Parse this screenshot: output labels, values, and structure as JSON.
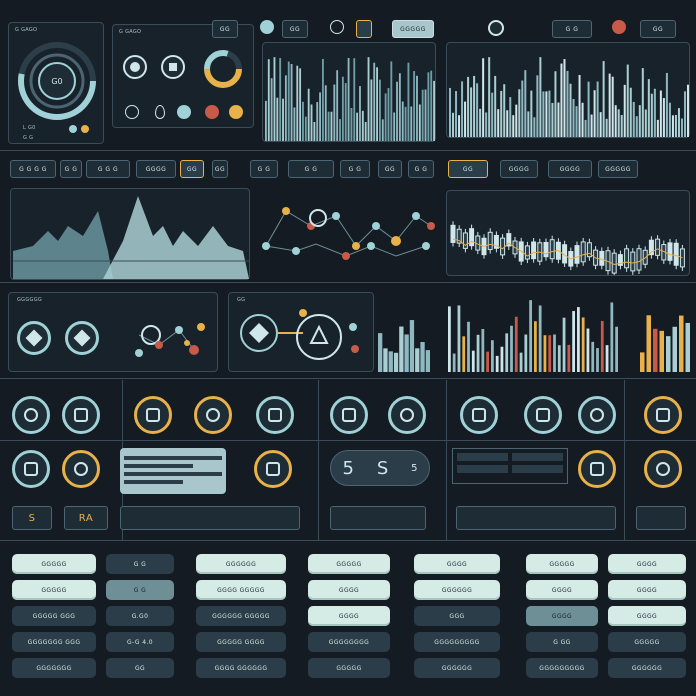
{
  "top": {
    "panel1_label": "G  GAGO",
    "panel2_label": "G  GAGO",
    "panel2_tag": "GG",
    "gauge_text": "G0",
    "mini_code": "L G0",
    "mini_code2": "G  G",
    "topbar_buttons": [
      "GG",
      "GG",
      "G  G",
      "GG"
    ],
    "topbar_right_label": "GGGGG",
    "topbar_pill2": "G  G"
  },
  "row2": {
    "buttons": [
      "G  G  G  G",
      "G G",
      "G  G  G",
      "GGGG",
      "GG",
      "GG",
      "G G",
      "G  G",
      "G  G",
      "GG",
      "G  G",
      "GG",
      "GGGG",
      "GGGG",
      "GGGGG"
    ]
  },
  "row3": {
    "section_label": "GGGGGG",
    "buttons": [
      "G",
      "G"
    ]
  },
  "row4": {
    "icon_names": [
      "hash-icon",
      "diamond-icon",
      "cat-icon",
      "monitor-icon",
      "laptop-icon",
      "target-icon",
      "dollar-icon",
      "puzzle-icon",
      "dollar-pin-icon",
      "frame-pin-icon",
      "infinity-icon"
    ],
    "s_label": "S",
    "s_tag": "5",
    "counter_text": "5",
    "tab_labels": [
      "S",
      "RA"
    ]
  },
  "pills": {
    "col1": [
      "GGGGG",
      "GGGGG",
      "GGGGG GGG",
      "GGGGGGG GGG",
      "GGGGGGG"
    ],
    "col2": [
      "G  G",
      "G G",
      "G.G0",
      "G-G  4.0",
      "GG"
    ],
    "col3": [
      "GGGGGG",
      "GGGG  GGGGG",
      "GGGGGG GGGGG",
      "GGGGG GGGG",
      "GGGG GGGGGG"
    ],
    "col4": [
      "GGGGG",
      "GGGG",
      "GGGG",
      "GGGGGGGG",
      "GGGGG"
    ],
    "col5": [
      "GGGG",
      "GGGGGG",
      "GGG",
      "GGGGGGGGG",
      "GGGGGG"
    ],
    "col6": [
      "GGGGG",
      "GGGG",
      "GGGG",
      "G  GG",
      "GGGGGGGGG"
    ],
    "col7": [
      "GGGG",
      "GGGG",
      "GGGG",
      "GGGGG",
      "GGGGGG"
    ]
  },
  "colors": {
    "bg": "#141b22",
    "panel": "#18222b",
    "teal": "#9fd1d6",
    "accent": "#e8b14a",
    "red": "#c85a4a"
  }
}
